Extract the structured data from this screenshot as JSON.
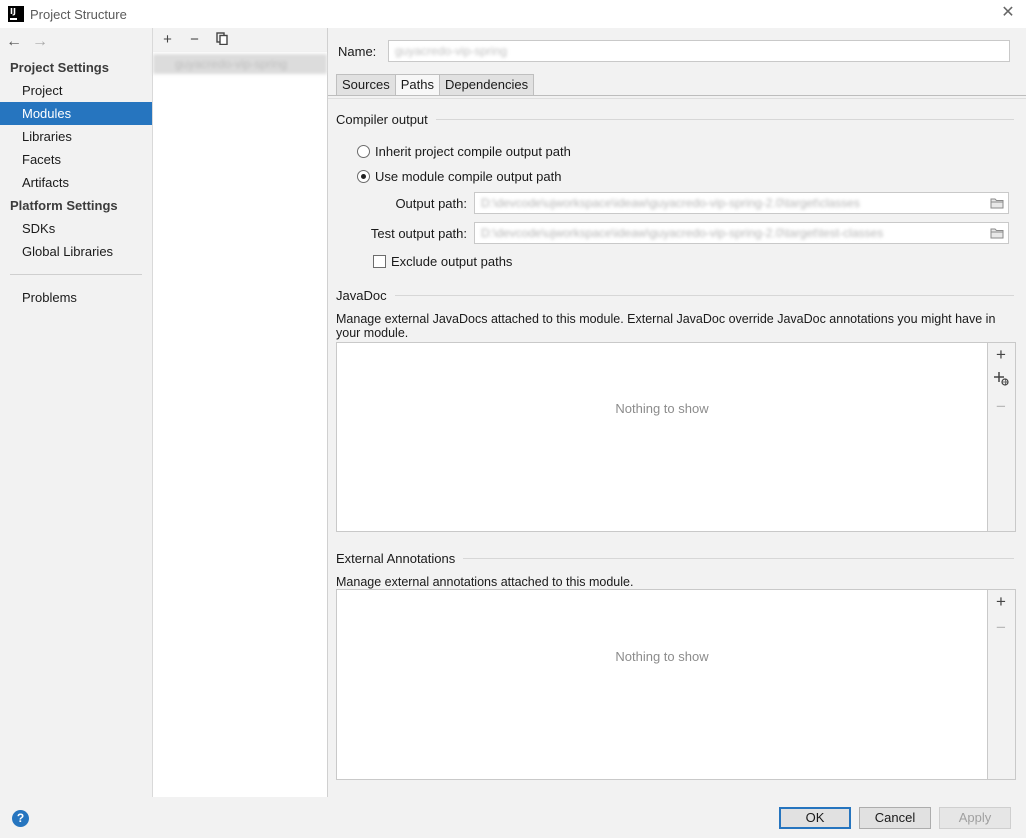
{
  "window": {
    "title": "Project Structure",
    "app_icon": "IJ"
  },
  "sidebar": {
    "project_settings_header": "Project Settings",
    "project_items": [
      "Project",
      "Modules",
      "Libraries",
      "Facets",
      "Artifacts"
    ],
    "platform_settings_header": "Platform Settings",
    "platform_items": [
      "SDKs",
      "Global Libraries"
    ],
    "problems": "Problems",
    "selected": "Modules"
  },
  "module_list": {
    "toolbar": {
      "add": "+",
      "remove": "−",
      "copy_icon": "copy-icon"
    },
    "items": [
      "guyacredo-vip-spring"
    ]
  },
  "main": {
    "name_label": "Name:",
    "name_value": "guyacredo-vip-spring",
    "tabs": [
      "Sources",
      "Paths",
      "Dependencies"
    ],
    "active_tab": "Paths",
    "compiler_output": {
      "title": "Compiler output",
      "inherit_label": "Inherit project compile output path",
      "use_module_label": "Use module compile output path",
      "selected": "use_module",
      "output_path_label": "Output path:",
      "output_path_value": "D:\\devcode\\ujworkspace\\ideaw\\guyacredo-vip-spring-2.0\\target\\classes",
      "test_output_path_label": "Test output path:",
      "test_output_path_value": "D:\\devcode\\ujworkspace\\ideaw\\guyacredo-vip-spring-2.0\\target\\test-classes",
      "exclude_label": "Exclude output paths",
      "exclude_checked": false
    },
    "javadoc": {
      "title": "JavaDoc",
      "description": "Manage external JavaDocs attached to this module. External JavaDoc override JavaDoc annotations you might have in your module.",
      "empty_text": "Nothing to show"
    },
    "external_annotations": {
      "title": "External Annotations",
      "description": "Manage external annotations attached to this module.",
      "empty_text": "Nothing to show"
    }
  },
  "footer": {
    "help": "?",
    "ok": "OK",
    "cancel": "Cancel",
    "apply": "Apply"
  },
  "colors": {
    "accent": "#2675bf",
    "background": "#f2f2f2"
  }
}
